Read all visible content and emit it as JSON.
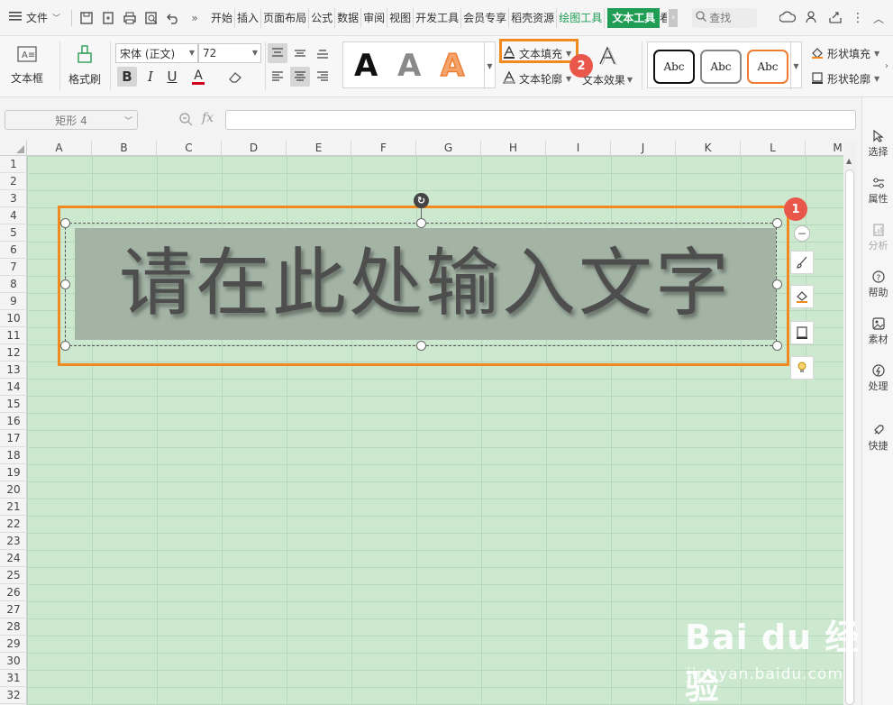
{
  "menubar": {
    "file_label": "文件",
    "tabs": [
      "开始",
      "插入",
      "页面布局",
      "公式",
      "数据",
      "审阅",
      "视图",
      "开发工具",
      "会员专享",
      "稻壳资源",
      "绘图工具",
      "文本工具",
      "看"
    ],
    "search_label": "查找"
  },
  "ribbon": {
    "textbox_label": "文本框",
    "format_painter_label": "格式刷",
    "font_name": "宋体 (正文)",
    "font_size": "72",
    "bold": "B",
    "italic": "I",
    "underline": "U",
    "font_color_glyph": "A",
    "style_letter": "A",
    "text_fill_label": "文本填充",
    "text_outline_label": "文本轮廓",
    "text_effect_label": "文本效果",
    "shape_style_sample": "Abc",
    "shape_fill_label": "形状填充",
    "shape_outline_label": "形状轮廓",
    "accent_color": "#f08a1e"
  },
  "formula_bar": {
    "name_box": "矩形 4",
    "fx_label": "fx",
    "value": ""
  },
  "sheet": {
    "columns": [
      "A",
      "B",
      "C",
      "D",
      "E",
      "F",
      "G",
      "H",
      "I",
      "J",
      "K",
      "L",
      "M"
    ],
    "rows": [
      "1",
      "2",
      "3",
      "4",
      "5",
      "6",
      "7",
      "8",
      "9",
      "10",
      "11",
      "12",
      "13",
      "14",
      "15",
      "16",
      "17",
      "18",
      "19",
      "20",
      "21",
      "22",
      "23",
      "24",
      "25",
      "26",
      "27",
      "28",
      "29",
      "30",
      "31",
      "32"
    ],
    "grid_color": "#cce8cf"
  },
  "shape": {
    "text": "请在此处输入文字",
    "fill_color": "#a3b4a5",
    "text_color": "#4e4e4e"
  },
  "badges": {
    "one": "1",
    "two": "2",
    "color": "#e9574b"
  },
  "right_panel": {
    "items": [
      "选择",
      "属性",
      "分析",
      "帮助",
      "素材",
      "处理",
      "快捷"
    ]
  },
  "watermark": {
    "line1": "Bai du 经验",
    "line2": "jingyan.baidu.com"
  }
}
